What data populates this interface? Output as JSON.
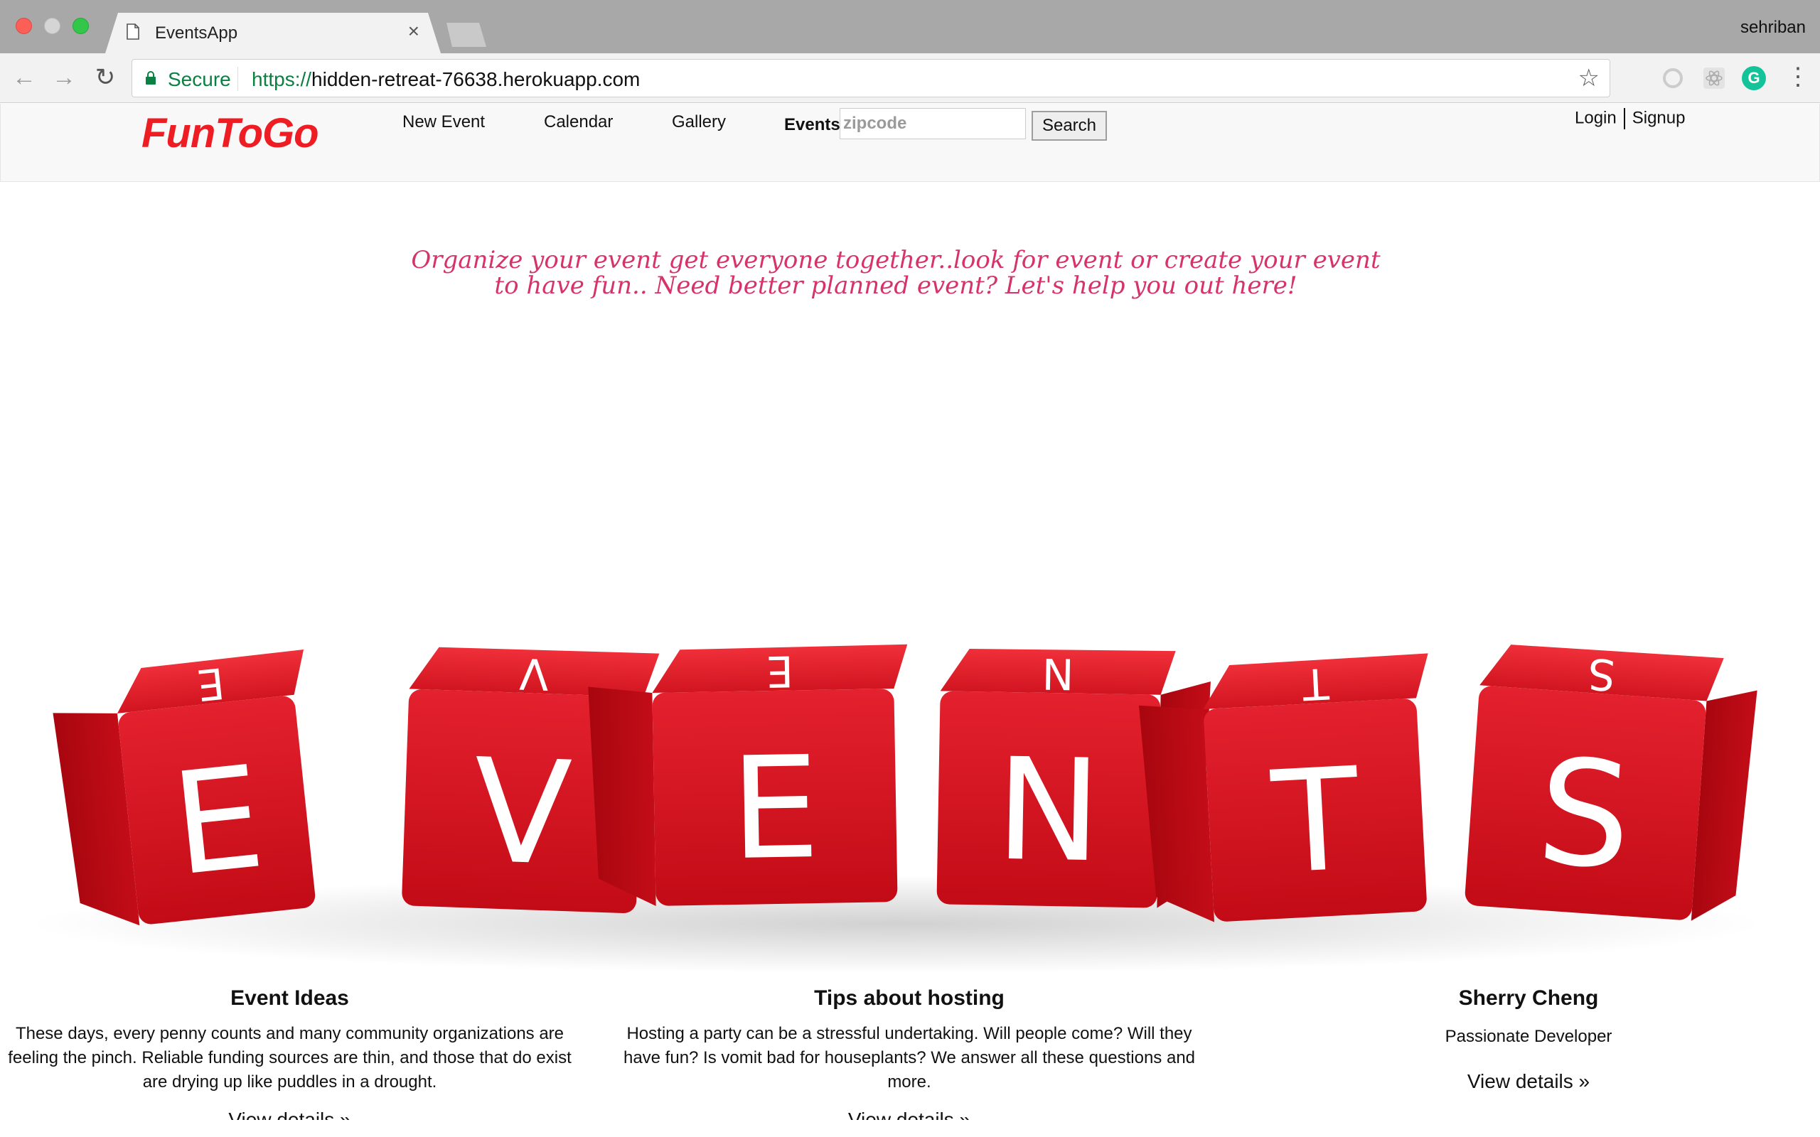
{
  "browser": {
    "tab_title": "EventsApp",
    "tab_close": "×",
    "profile_name": "sehriban",
    "secure_label": "Secure",
    "url_scheme": "https://",
    "url_host": "hidden-retreat-76638.herokuapp.com",
    "icons": [
      "back-arrow-icon",
      "forward-arrow-icon",
      "reload-icon",
      "lock-icon",
      "star-icon",
      "extension-icon",
      "react-devtools-icon",
      "grammarly-icon",
      "menu-icon"
    ]
  },
  "header": {
    "brand": "FunToGo",
    "nav": [
      "New Event",
      "Calendar",
      "Gallery"
    ],
    "events_label": "Events",
    "zip_placeholder": "zipcode",
    "search_label": "Search",
    "login_label": "Login",
    "signup_label": "Signup"
  },
  "tagline": "Organize your event get everyone together..look for event or create your event to have fun.. Need better planned event? Let's help you out here!",
  "hero": {
    "letters": [
      "E",
      "V",
      "E",
      "N",
      "T",
      "S"
    ]
  },
  "columns": [
    {
      "title": "Event Ideas",
      "text": "These days, every penny counts and many community organizations are feeling the pinch. Reliable funding sources are thin, and those that do exist are drying up like puddles in a drought.",
      "link": "View details »"
    },
    {
      "title": "Tips about hosting",
      "text": "Hosting a party can be a stressful undertaking. Will people come? Will they have fun? Is vomit bad for houseplants? We answer all these questions and more.",
      "link": "View details »"
    },
    {
      "title": "Sherry Cheng",
      "text": "Passionate Developer",
      "link": "View details »"
    }
  ],
  "colors": {
    "brand": "#ee1d23",
    "tagline": "#d6336c",
    "dice": "#d90f1c"
  }
}
